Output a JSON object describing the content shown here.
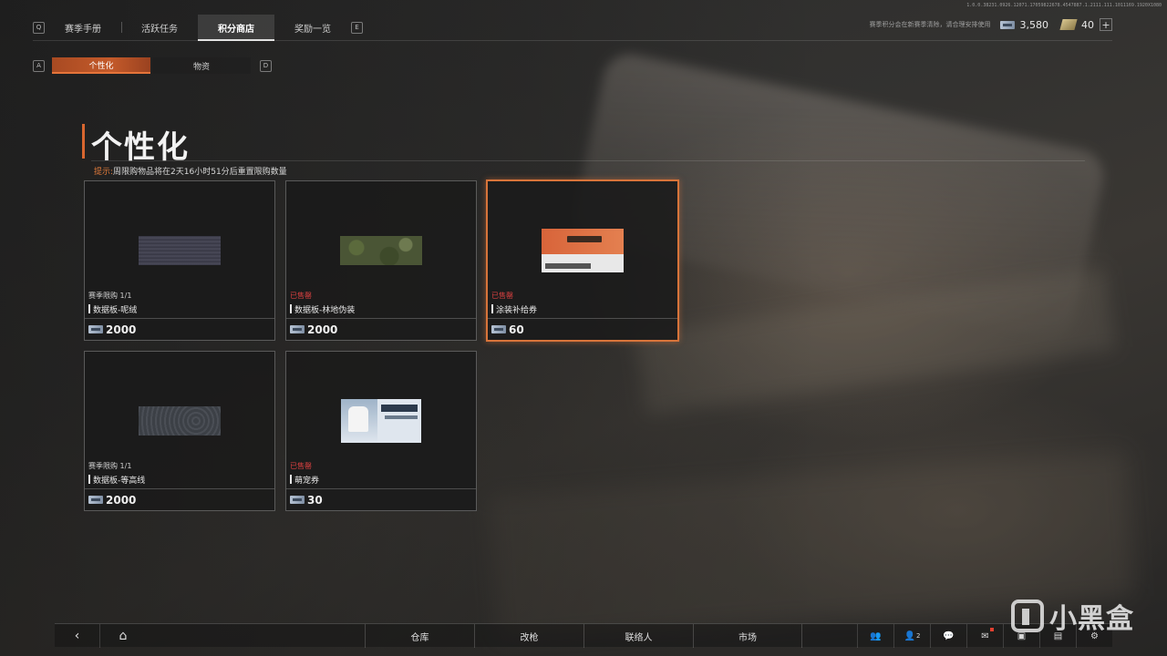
{
  "build_info": "1.0.0.38231.0926.12071.17059822678.4547887.1.2111.111.1011169.1920X1080",
  "top_nav": {
    "key_left": "Q",
    "key_right": "E",
    "tabs": [
      {
        "label": "赛季手册"
      },
      {
        "label": "活跃任务"
      },
      {
        "label": "积分商店"
      },
      {
        "label": "奖励一览"
      }
    ],
    "active_index": 2
  },
  "currency": {
    "season_note": "赛季积分会在新赛季清除，请合理安排使用",
    "points": "3,580",
    "gold": "40",
    "plus_label": "+"
  },
  "sub_nav": {
    "key_left": "A",
    "key_right": "D",
    "tabs": [
      {
        "label": "个性化"
      },
      {
        "label": "物资"
      }
    ],
    "active_index": 0
  },
  "section": {
    "title": "个性化",
    "hint_label": "提示:",
    "hint_text": "周限购物品将在2天16小时51分后重置限购数量"
  },
  "items": [
    {
      "status": "赛季限购 1/1",
      "sold_out": false,
      "name": "数据板-呢绒",
      "price": "2000",
      "thumb": "wool"
    },
    {
      "status": "已售罄",
      "sold_out": true,
      "name": "数据板-林地伪装",
      "price": "2000",
      "thumb": "woodland"
    },
    {
      "status": "已售罄",
      "sold_out": true,
      "name": "涂装补给券",
      "price": "60",
      "thumb": "voucher",
      "selected": true
    },
    {
      "status": "赛季限购 1/1",
      "sold_out": false,
      "name": "数据板-等高线",
      "price": "2000",
      "thumb": "topo"
    },
    {
      "status": "已售罄",
      "sold_out": true,
      "name": "萌宠券",
      "price": "30",
      "thumb": "pet"
    }
  ],
  "bottom_bar": {
    "back_icon": "‹",
    "home_icon": "⌂",
    "tabs": [
      {
        "label": "仓库"
      },
      {
        "label": "改枪"
      },
      {
        "label": "联络人"
      },
      {
        "label": "市场"
      }
    ],
    "friends_count": "2"
  },
  "watermark": {
    "text": "小黑盒"
  },
  "colors": {
    "accent": "#d8662f",
    "sold_out": "#d84040"
  }
}
